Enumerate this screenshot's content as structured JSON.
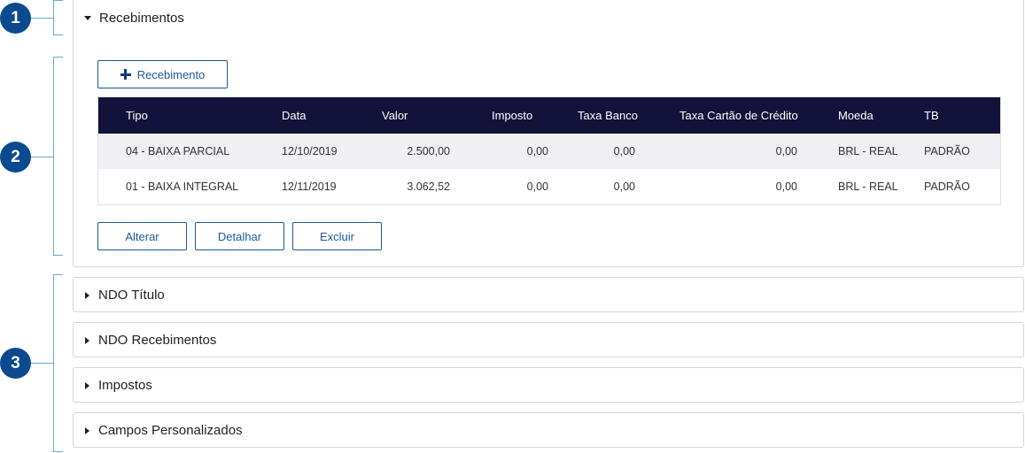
{
  "callouts": [
    "1",
    "2",
    "3"
  ],
  "recebimentos": {
    "title": "Recebimentos",
    "add_button": "Recebimento",
    "columns": [
      "Tipo",
      "Data",
      "Valor",
      "Imposto",
      "Taxa Banco",
      "Taxa Cartão de Crédito",
      "Moeda",
      "TB"
    ],
    "rows": [
      {
        "tipo": "04 - BAIXA PARCIAL",
        "data": "12/10/2019",
        "valor": "2.500,00",
        "imposto": "0,00",
        "taxa_banco": "0,00",
        "taxa_cartao": "0,00",
        "moeda": "BRL - REAL",
        "tb": "PADRÃO"
      },
      {
        "tipo": "01 - BAIXA INTEGRAL",
        "data": "12/11/2019",
        "valor": "3.062,52",
        "imposto": "0,00",
        "taxa_banco": "0,00",
        "taxa_cartao": "0,00",
        "moeda": "BRL - REAL",
        "tb": "PADRÃO"
      }
    ],
    "actions": {
      "alterar": "Alterar",
      "detalhar": "Detalhar",
      "excluir": "Excluir"
    }
  },
  "sections": [
    {
      "title": "NDO Título"
    },
    {
      "title": "NDO Recebimentos"
    },
    {
      "title": "Impostos"
    },
    {
      "title": "Campos Personalizados"
    }
  ]
}
